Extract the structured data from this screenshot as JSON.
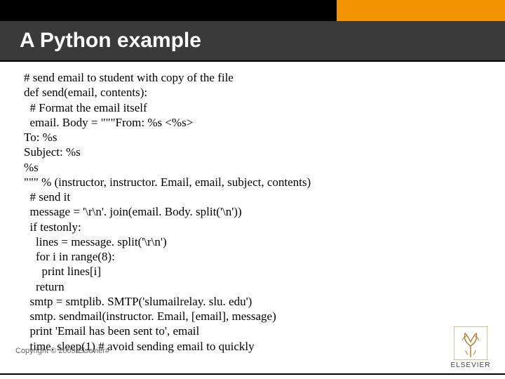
{
  "header": {
    "title": "A Python example"
  },
  "code": {
    "lines": [
      "# send email to student with copy of the file",
      "def send(email, contents):",
      "  # Format the email itself",
      "  email. Body = \"\"\"From: %s <%s>",
      "To: %s",
      "Subject: %s",
      "%s",
      "\"\"\" % (instructor, instructor. Email, email, subject, contents)",
      "  # send it",
      "  message = '\\r\\n'. join(email. Body. split('\\n'))",
      "  if testonly:",
      "    lines = message. split('\\r\\n')",
      "    for i in range(8):",
      "      print lines[i]",
      "    return",
      "  smtp = smtplib. SMTP('slumailrelay. slu. edu')",
      "  smtp. sendmail(instructor. Email, [email], message)",
      "  print 'Email has been sent to', email",
      "  time. sleep(1) # avoid sending email to quickly"
    ]
  },
  "footer": {
    "copyright": "Copyright © 2009 Elsevier#",
    "publisher": "ELSEVIER"
  },
  "colors": {
    "accent_orange": "#f29400",
    "title_band": "#3a3a3a"
  }
}
